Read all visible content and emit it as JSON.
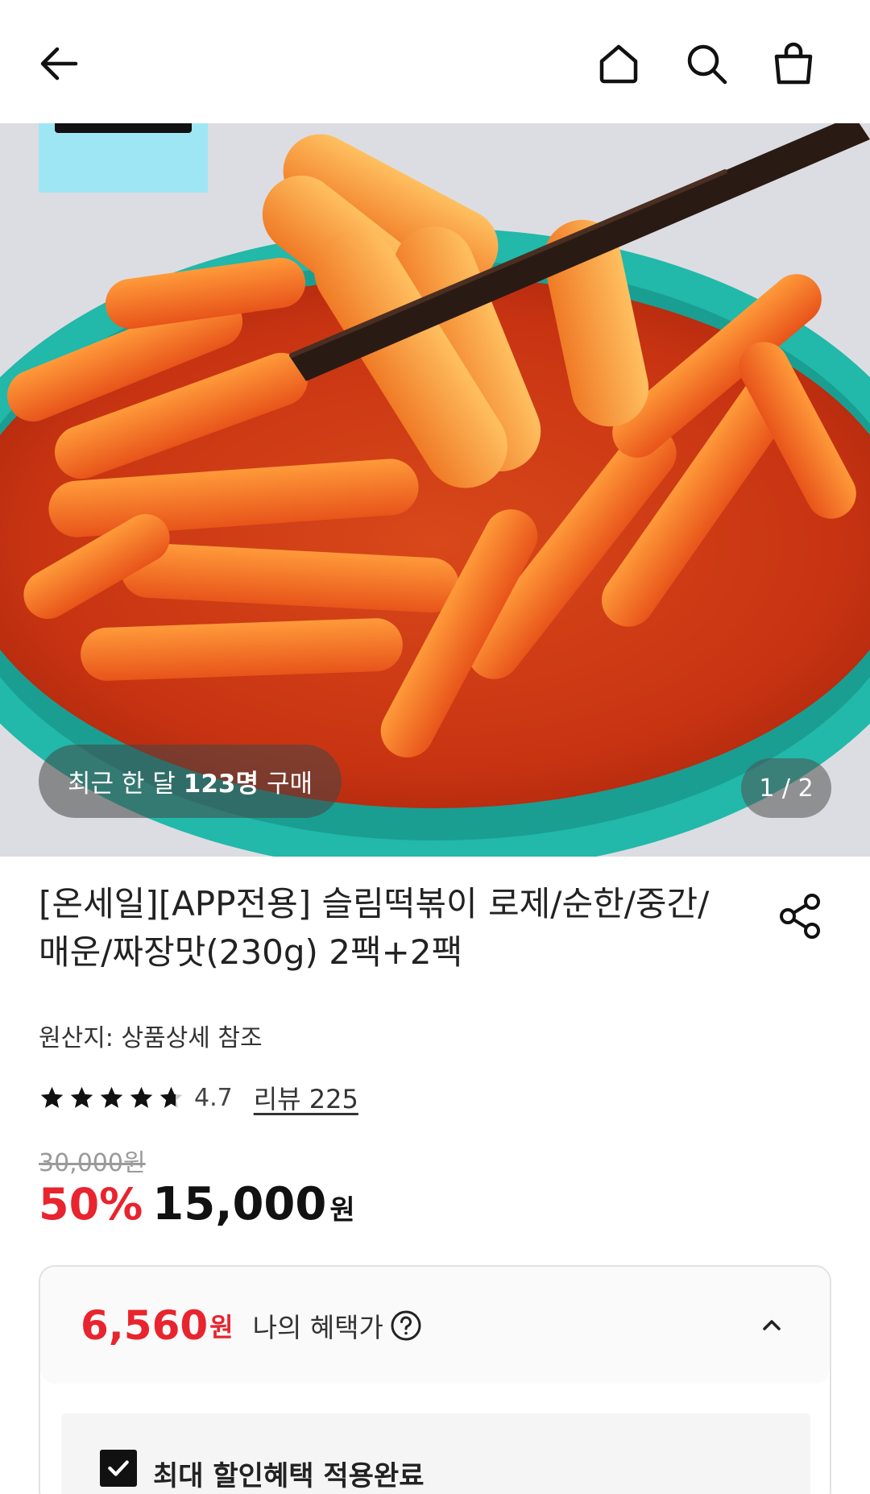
{
  "header": {
    "back_icon": "arrow-left-icon",
    "home_icon": "home-icon",
    "search_icon": "search-icon",
    "cart_icon": "shopping-bag-icon"
  },
  "hero": {
    "buyers_prefix": "최근 한 달",
    "buyers_count": "123명",
    "buyers_suffix": "구매",
    "image_counter": "1 / 2"
  },
  "product": {
    "title": "[온세일][APP전용] 슬림떡볶이 로제/순한/중간/매운/짜장맛(230g) 2팩+2팩",
    "share_icon": "share-icon",
    "origin": "원산지: 상품상세 참조",
    "rating": "4.7",
    "rating_stars": 4.7,
    "review_label": "리뷰 225",
    "original_price": "30,000원",
    "discount": "50%",
    "price": "15,000",
    "currency": "원"
  },
  "benefit": {
    "price": "6,560",
    "currency": "원",
    "label": "나의 혜택가",
    "applied_label": "최대 할인혜택 적용완료"
  },
  "colors": {
    "accent_red": "#e8242e",
    "text": "#222222",
    "bowl": "#1fb3a6"
  }
}
